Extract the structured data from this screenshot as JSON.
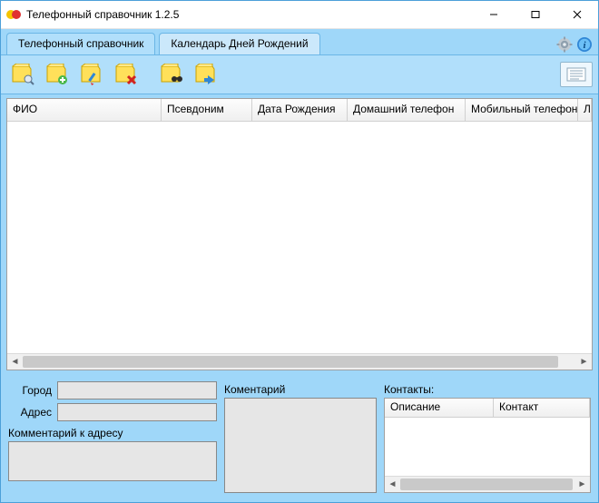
{
  "window": {
    "title": "Телефонный справочник 1.2.5"
  },
  "tabs": {
    "directory": "Телефонный справочник",
    "birthdays": "Календарь Дней Рождений"
  },
  "grid": {
    "columns": {
      "fio": "ФИО",
      "nickname": "Псевдоним",
      "dob": "Дата Рождения",
      "home_phone": "Домашний телефон",
      "mobile_phone": "Мобильный телефон",
      "extra": "Л"
    },
    "rows": []
  },
  "bottom": {
    "city_label": "Город",
    "address_label": "Адрес",
    "address_comment_label": "Комментарий к адресу",
    "comment_label": "Коментарий",
    "contacts_label": "Контакты:",
    "city_value": "",
    "address_value": "",
    "address_comment_value": "",
    "comment_value": ""
  },
  "contacts_grid": {
    "columns": {
      "description": "Описание",
      "contact": "Контакт"
    },
    "rows": []
  }
}
